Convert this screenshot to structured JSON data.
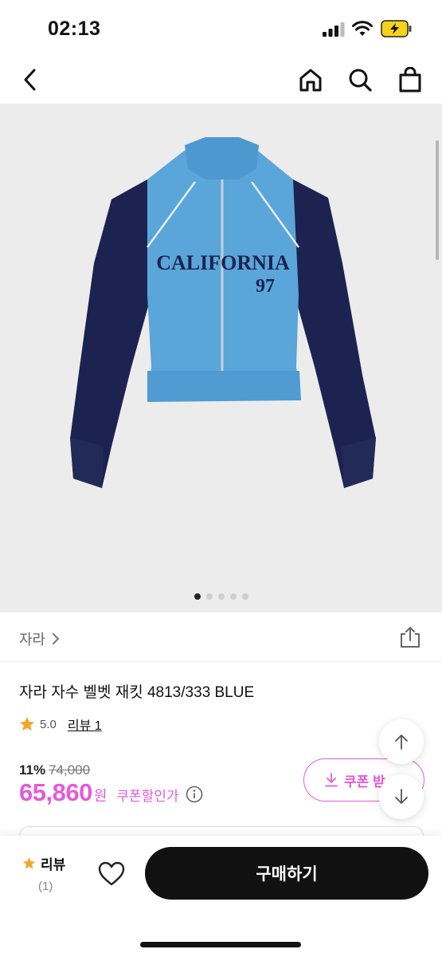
{
  "status_bar": {
    "time": "02:13"
  },
  "nav": {
    "back_icon": "chevron-left-icon",
    "home_icon": "home-icon",
    "search_icon": "search-icon",
    "bag_icon": "shopping-bag-icon"
  },
  "product_image": {
    "jacket_text": "CALIFORNIA",
    "jacket_number": "97",
    "page_indicator_total": 5,
    "page_indicator_active": 1
  },
  "brand": {
    "name": "자라",
    "chevron": ">"
  },
  "product": {
    "title": "자라 자수 벨벳 재킷 4813/333 BLUE",
    "rating": "5.0",
    "review_link": "리뷰 1",
    "discount_percent": "11%",
    "original_price": "74,000",
    "price": "65,860",
    "currency": "원",
    "coupon_price_label": "쿠폰할인가"
  },
  "coupon_button": {
    "label": "쿠폰 받"
  },
  "bottom_bar": {
    "review_label": "리뷰",
    "review_count": "(1)",
    "buy_label": "구매하기"
  },
  "colors": {
    "accent_pink": "#e35bd9",
    "star": "#f4a62a",
    "buy_button": "#111111"
  }
}
